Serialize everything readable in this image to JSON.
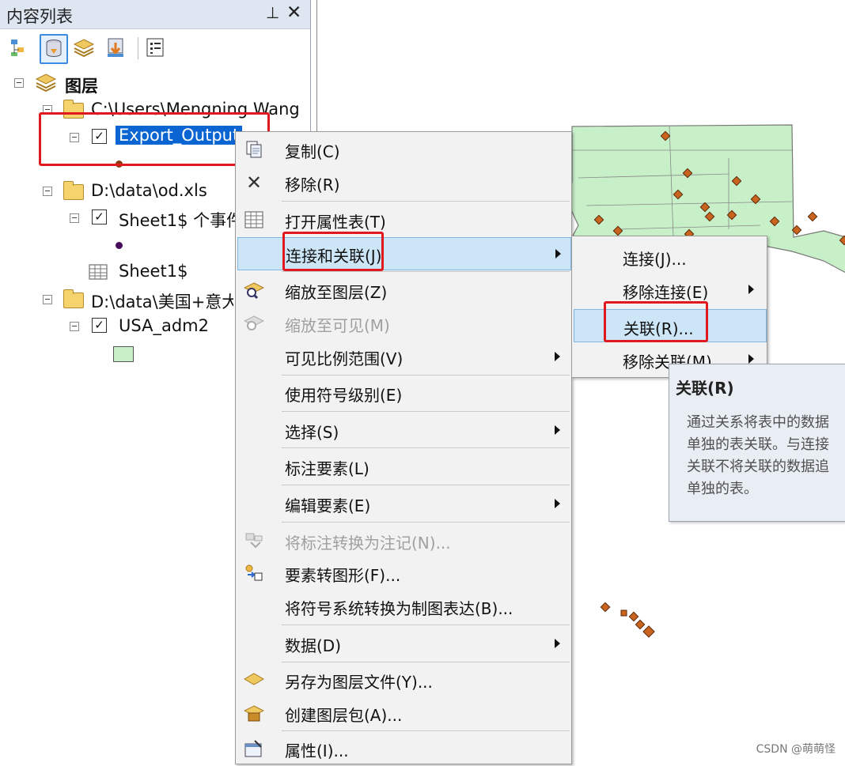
{
  "toc": {
    "title": "内容列表",
    "pin_glyph": "ꟼ",
    "close_glyph": "✕",
    "root_label": "图层",
    "items": [
      {
        "label": "C:\\Users\\Mengning Wang"
      },
      {
        "label": "Export_Output"
      },
      {
        "label": "D:\\data\\od.xls"
      },
      {
        "label": "Sheet1$ 个事件"
      },
      {
        "label": "Sheet1$"
      },
      {
        "label": "D:\\data\\美国+意大"
      },
      {
        "label": "USA_adm2"
      }
    ],
    "check_glyph": "✓"
  },
  "context_menu": {
    "items": [
      {
        "label": "复制(C)"
      },
      {
        "label": "移除(R)"
      },
      {
        "label": "打开属性表(T)"
      },
      {
        "label": "连接和关联(J)"
      },
      {
        "label": "缩放至图层(Z)"
      },
      {
        "label": "缩放至可见(M)"
      },
      {
        "label": "可见比例范围(V)"
      },
      {
        "label": "使用符号级别(E)"
      },
      {
        "label": "选择(S)"
      },
      {
        "label": "标注要素(L)"
      },
      {
        "label": "编辑要素(E)"
      },
      {
        "label": "将标注转换为注记(N)..."
      },
      {
        "label": "要素转图形(F)..."
      },
      {
        "label": "将符号系统转换为制图表达(B)..."
      },
      {
        "label": "数据(D)"
      },
      {
        "label": "另存为图层文件(Y)..."
      },
      {
        "label": "创建图层包(A)..."
      },
      {
        "label": "属性(I)..."
      }
    ]
  },
  "submenu": {
    "items": [
      {
        "label": "连接(J)..."
      },
      {
        "label": "移除连接(E)"
      },
      {
        "label": "关联(R)..."
      },
      {
        "label": "移除关联(M)"
      }
    ]
  },
  "tooltip": {
    "title": "关联(R)",
    "lines": [
      "通过关系将表中的数据",
      "单独的表关联。与连接",
      "关联不将关联的数据追",
      "单独的表。"
    ]
  },
  "watermark": "CSDN @萌萌怪",
  "colors": {
    "map_fill": "#c8f0c8",
    "highlight": "#cde6f7",
    "selection": "#0a64d1",
    "callout": "#e0191e",
    "point": "#c8641e"
  }
}
